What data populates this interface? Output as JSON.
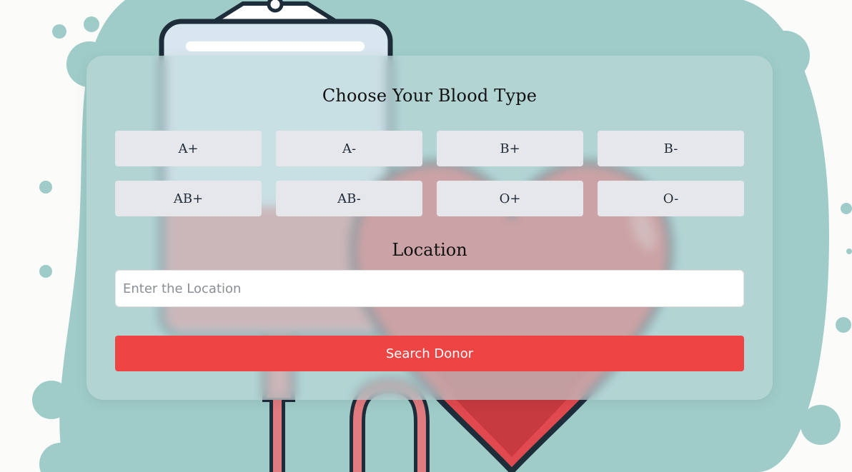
{
  "heading": "Choose Your Blood Type",
  "blood_types": [
    "A+",
    "A-",
    "B+",
    "B-",
    "AB+",
    "AB-",
    "O+",
    "O-"
  ],
  "location": {
    "heading": "Location",
    "placeholder": "Enter the Location",
    "value": ""
  },
  "search_button": "Search Donor",
  "colors": {
    "accent": "#ef4444",
    "blob": "#9fccc9",
    "heart": "#e04a4f",
    "button_bg": "#e5e7eb"
  },
  "background_art": [
    "blood-bag-illustration",
    "heart-illustration",
    "decorative-dots"
  ]
}
